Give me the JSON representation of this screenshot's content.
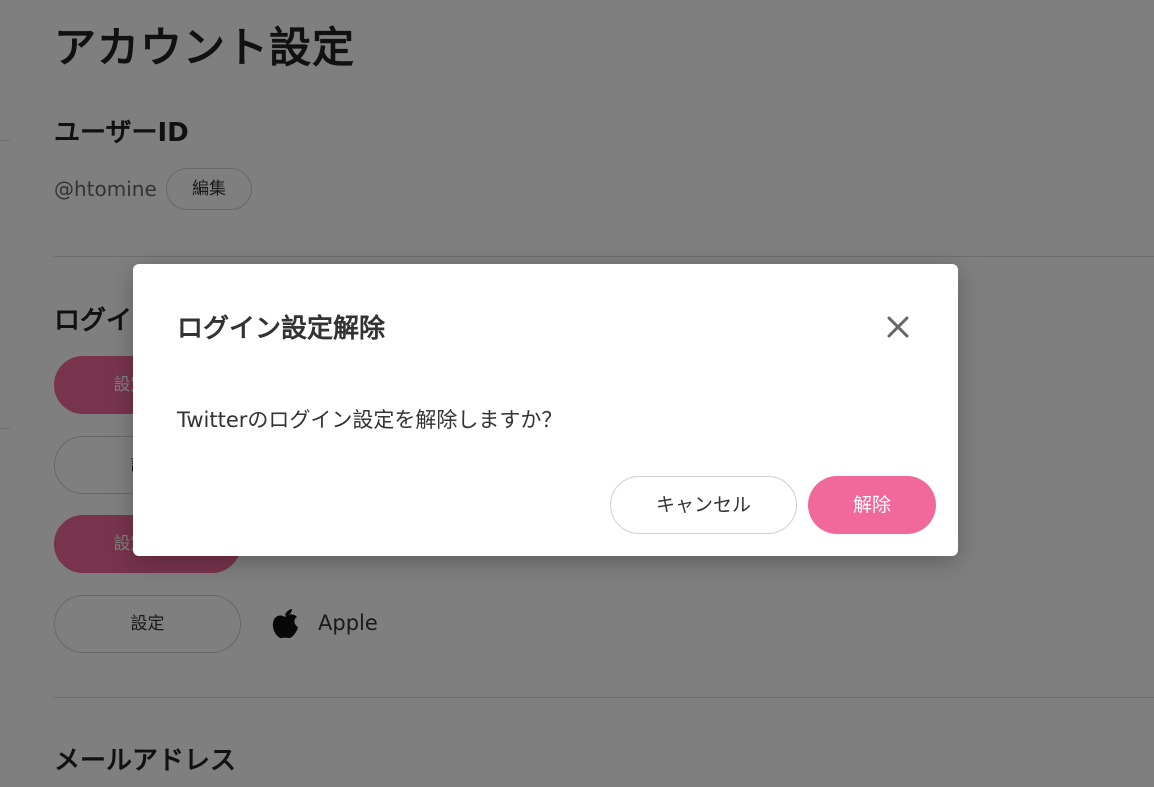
{
  "page": {
    "title": "アカウント設定",
    "user_id_section": {
      "title": "ユーザーID",
      "user_id": "@htomine",
      "edit_label": "編集"
    },
    "login_section": {
      "title": "ログイン設定",
      "items": [
        {
          "button_label": "設定解除",
          "provider": ""
        },
        {
          "button_label": "設定",
          "provider": ""
        },
        {
          "button_label": "設定解除",
          "provider": ""
        },
        {
          "button_label": "設定",
          "provider": "Apple",
          "icon": "apple-icon"
        }
      ]
    },
    "email_section": {
      "title": "メールアドレス"
    }
  },
  "modal": {
    "title": "ログイン設定解除",
    "message": "Twitterのログイン設定を解除しますか？",
    "cancel_label": "キャンセル",
    "confirm_label": "解除",
    "close_icon": "close-icon"
  },
  "colors": {
    "accent": "#f0699a",
    "overlay": "rgba(0,0,0,0.5)",
    "text": "#333333"
  }
}
